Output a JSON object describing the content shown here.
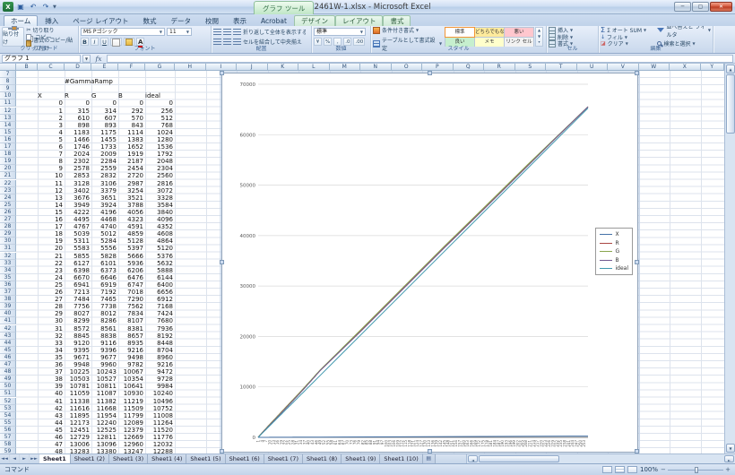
{
  "window": {
    "title": "SX2461W-1.xlsx - Microsoft Excel",
    "contextual_tool": "グラフ ツール",
    "minimize": "─",
    "maximize": "▢",
    "close": "✕"
  },
  "ribbon": {
    "tabs": [
      {
        "label": "ホーム",
        "active": true,
        "ctx": false
      },
      {
        "label": "挿入",
        "active": false,
        "ctx": false
      },
      {
        "label": "ページ レイアウト",
        "active": false,
        "ctx": false
      },
      {
        "label": "数式",
        "active": false,
        "ctx": false
      },
      {
        "label": "データ",
        "active": false,
        "ctx": false
      },
      {
        "label": "校閲",
        "active": false,
        "ctx": false
      },
      {
        "label": "表示",
        "active": false,
        "ctx": false
      },
      {
        "label": "Acrobat",
        "active": false,
        "ctx": false
      },
      {
        "label": "デザイン",
        "active": false,
        "ctx": true
      },
      {
        "label": "レイアウト",
        "active": false,
        "ctx": true
      },
      {
        "label": "書式",
        "active": false,
        "ctx": true
      }
    ],
    "groups": {
      "clipboard": {
        "label": "クリップボード",
        "paste": "貼り付け",
        "items": [
          "切り取り",
          "コピー",
          "書式のコピー/貼り付け"
        ]
      },
      "font": {
        "label": "フォント",
        "name": "MS Pゴシック",
        "size": "11",
        "bold": "B",
        "italic": "I",
        "underline": "U"
      },
      "alignment": {
        "label": "配置",
        "wrap": "折り返して全体を表示する",
        "merge": "セルを結合して中央揃え"
      },
      "number": {
        "label": "数値",
        "format": "標準",
        "buttons": [
          "¥",
          "%",
          ",",
          ".0",
          ".00"
        ]
      },
      "styles": {
        "label": "スタイル",
        "conditional": "条件付き書式",
        "as_table": "テーブルとして書式設定",
        "gallery": [
          {
            "label": "標準",
            "bg": "#ffffff"
          },
          {
            "label": "どちらでもない",
            "bg": "#ffeb9c"
          },
          {
            "label": "悪い",
            "bg": "#ffc7ce"
          },
          {
            "label": "良い",
            "bg": "#c6efce"
          },
          {
            "label": "メモ",
            "bg": "#ffffcc"
          },
          {
            "label": "リンク セル",
            "bg": "#f2f2f2"
          }
        ]
      },
      "cells": {
        "label": "セル",
        "items": [
          "挿入",
          "削除",
          "書式"
        ]
      },
      "editing": {
        "label": "編集",
        "sum": "Σ オート SUM",
        "fill": "フィル",
        "clear": "クリア",
        "sort": "並べ替えと フィルタ",
        "find": "検索と選択"
      }
    }
  },
  "formula_bar": {
    "name_box": "グラフ 1",
    "fx": "fx"
  },
  "spreadsheet": {
    "columns": [
      "B",
      "C",
      "D",
      "E",
      "F",
      "G",
      "H",
      "I",
      "J",
      "K",
      "L",
      "M",
      "N",
      "O",
      "P",
      "Q",
      "R",
      "S",
      "T",
      "U",
      "V",
      "W",
      "X",
      "Y"
    ],
    "row_start": 7,
    "row_end": 59,
    "table": {
      "title": "#GammaRamp",
      "headers": [
        "X",
        "R",
        "G",
        "B",
        "ideal"
      ],
      "rows": [
        [
          0,
          0,
          0,
          0,
          0
        ],
        [
          1,
          315,
          314,
          292,
          256
        ],
        [
          2,
          610,
          607,
          570,
          512
        ],
        [
          3,
          898,
          893,
          843,
          768
        ],
        [
          4,
          1183,
          1175,
          1114,
          1024
        ],
        [
          5,
          1466,
          1455,
          1383,
          1280
        ],
        [
          6,
          1746,
          1733,
          1652,
          1536
        ],
        [
          7,
          2024,
          2009,
          1919,
          1792
        ],
        [
          8,
          2302,
          2284,
          2187,
          2048
        ],
        [
          9,
          2578,
          2559,
          2454,
          2304
        ],
        [
          10,
          2853,
          2832,
          2720,
          2560
        ],
        [
          11,
          3128,
          3106,
          2987,
          2816
        ],
        [
          12,
          3402,
          3379,
          3254,
          3072
        ],
        [
          13,
          3676,
          3651,
          3521,
          3328
        ],
        [
          14,
          3949,
          3924,
          3788,
          3584
        ],
        [
          15,
          4222,
          4196,
          4056,
          3840
        ],
        [
          16,
          4495,
          4468,
          4323,
          4096
        ],
        [
          17,
          4767,
          4740,
          4591,
          4352
        ],
        [
          18,
          5039,
          5012,
          4859,
          4608
        ],
        [
          19,
          5311,
          5284,
          5128,
          4864
        ],
        [
          20,
          5583,
          5556,
          5397,
          5120
        ],
        [
          21,
          5855,
          5828,
          5666,
          5376
        ],
        [
          22,
          6127,
          6101,
          5936,
          5632
        ],
        [
          23,
          6398,
          6373,
          6206,
          5888
        ],
        [
          24,
          6670,
          6646,
          6476,
          6144
        ],
        [
          25,
          6941,
          6919,
          6747,
          6400
        ],
        [
          26,
          7213,
          7192,
          7018,
          6656
        ],
        [
          27,
          7484,
          7465,
          7290,
          6912
        ],
        [
          28,
          7756,
          7738,
          7562,
          7168
        ],
        [
          29,
          8027,
          8012,
          7834,
          7424
        ],
        [
          30,
          8299,
          8286,
          8107,
          7680
        ],
        [
          31,
          8572,
          8561,
          8381,
          7936
        ],
        [
          32,
          8845,
          8838,
          8657,
          8192
        ],
        [
          33,
          9120,
          9116,
          8935,
          8448
        ],
        [
          34,
          9395,
          9396,
          9216,
          8704
        ],
        [
          35,
          9671,
          9677,
          9498,
          8960
        ],
        [
          36,
          9948,
          9960,
          9782,
          9216
        ],
        [
          37,
          10225,
          10243,
          10067,
          9472
        ],
        [
          38,
          10503,
          10527,
          10354,
          9728
        ],
        [
          39,
          10781,
          10811,
          10641,
          9984
        ],
        [
          40,
          11059,
          11087,
          10930,
          10240
        ],
        [
          41,
          11338,
          11382,
          11219,
          10496
        ],
        [
          42,
          11616,
          11668,
          11509,
          10752
        ],
        [
          43,
          11895,
          11954,
          11799,
          11008
        ],
        [
          44,
          12173,
          12240,
          12089,
          11264
        ],
        [
          45,
          12451,
          12525,
          12379,
          11520
        ],
        [
          46,
          12729,
          12811,
          12669,
          11776
        ],
        [
          47,
          13006,
          13096,
          12960,
          12032
        ],
        [
          48,
          13283,
          13380,
          13247,
          12288
        ]
      ]
    }
  },
  "chart_data": {
    "type": "line",
    "title": "",
    "x_max": 255,
    "ylim": [
      0,
      70000
    ],
    "y_tick_step": 10000,
    "x_tick_start": 1,
    "x_tick_step": 3,
    "grid": true,
    "legend_position": "right",
    "series": [
      {
        "name": "X",
        "color": "#4572A7",
        "table_col": 0,
        "extension": [
          [
            255,
            255
          ]
        ]
      },
      {
        "name": "R",
        "color": "#AA4643",
        "table_col": 1,
        "extension": [
          [
            80,
            21300
          ],
          [
            112,
            29500
          ],
          [
            144,
            37700
          ],
          [
            176,
            45700
          ],
          [
            208,
            53800
          ],
          [
            232,
            59800
          ],
          [
            255,
            65535
          ]
        ]
      },
      {
        "name": "G",
        "color": "#89A54E",
        "table_col": 2,
        "extension": [
          [
            80,
            21500
          ],
          [
            112,
            29700
          ],
          [
            144,
            37900
          ],
          [
            176,
            45900
          ],
          [
            208,
            54000
          ],
          [
            232,
            59900
          ],
          [
            255,
            65535
          ]
        ]
      },
      {
        "name": "B",
        "color": "#71588F",
        "table_col": 3,
        "extension": [
          [
            80,
            21200
          ],
          [
            112,
            29400
          ],
          [
            144,
            37600
          ],
          [
            176,
            45600
          ],
          [
            208,
            53700
          ],
          [
            232,
            59800
          ],
          [
            255,
            65535
          ]
        ]
      },
      {
        "name": "ideal",
        "color": "#4198AF",
        "table_col": 4,
        "extension": [
          [
            255,
            65280
          ]
        ]
      }
    ]
  },
  "sheet_tabs": {
    "active": 0,
    "tabs": [
      "Sheet1",
      "Sheet1 (2)",
      "Sheet1 (3)",
      "Sheet1 (4)",
      "Sheet1 (5)",
      "Sheet1 (6)",
      "Sheet1 (7)",
      "Sheet1 (8)",
      "Sheet1 (9)",
      "Sheet1 (10)"
    ]
  },
  "status_bar": {
    "mode": "コマンド",
    "zoom": "100%"
  }
}
